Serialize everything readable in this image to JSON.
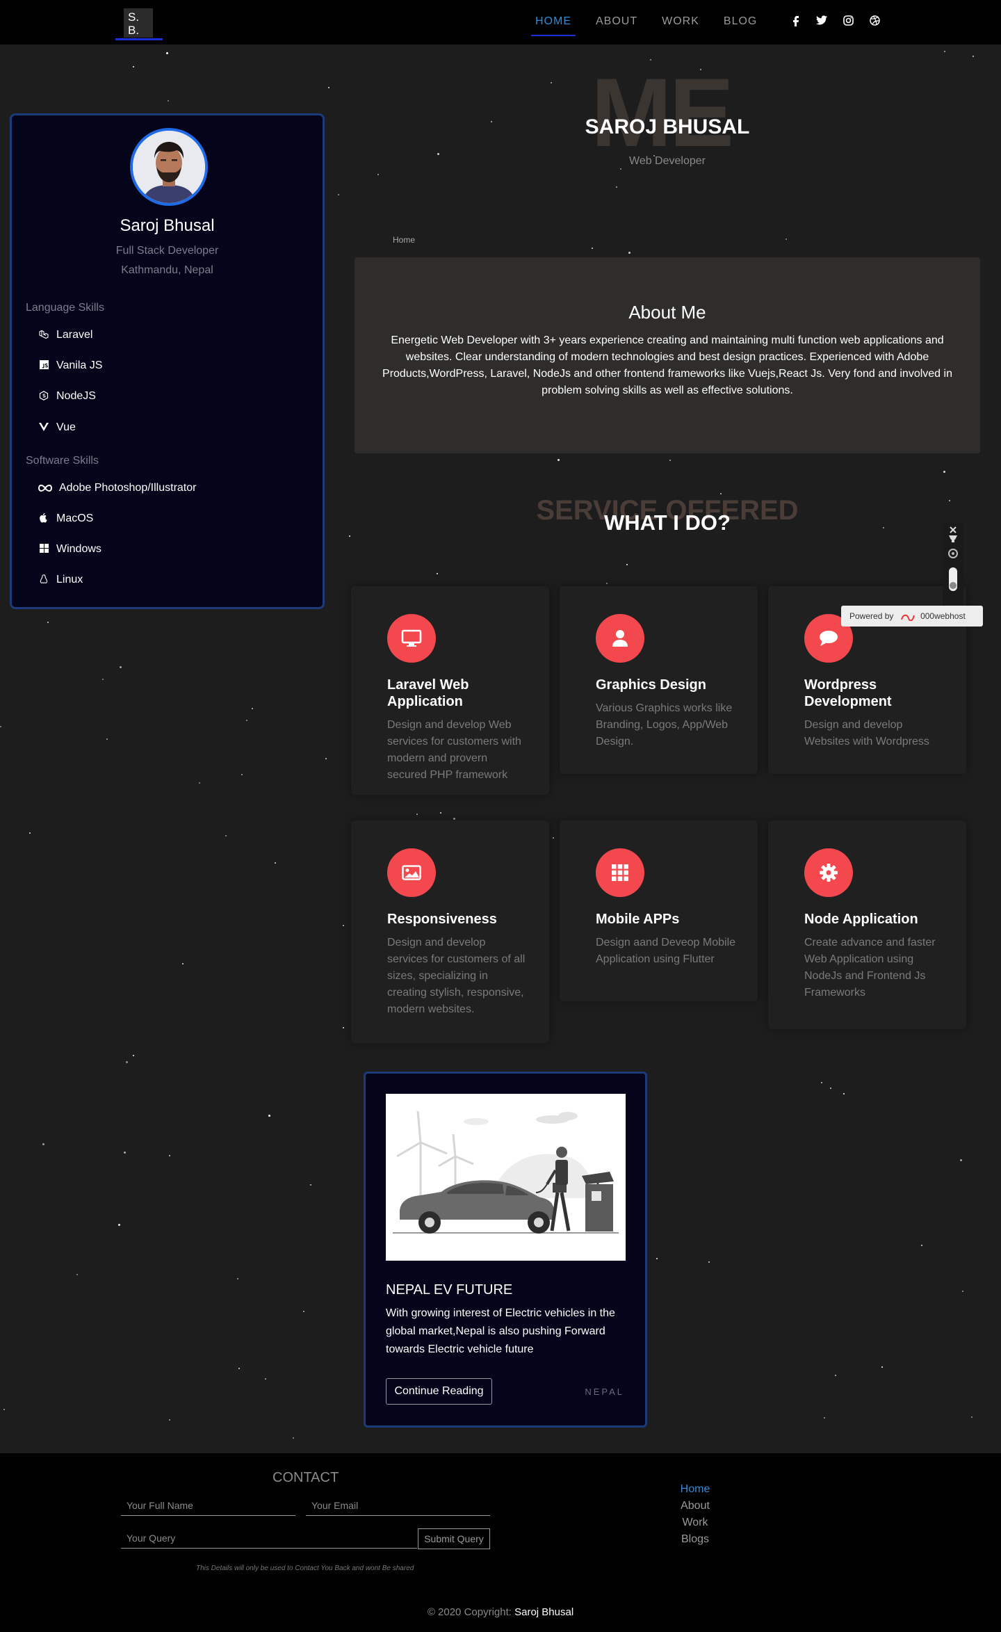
{
  "nav": {
    "logo": "S.\nB.",
    "links": [
      "HOME",
      "ABOUT",
      "WORK",
      "BLOG"
    ],
    "active": "HOME",
    "social_icons": [
      "facebook-icon",
      "twitter-icon",
      "instagram-icon",
      "dribbble-icon"
    ]
  },
  "sidebar": {
    "name": "Saroj Bhusal",
    "role": "Full Stack Developer",
    "location": "Kathmandu, Nepal",
    "language_heading": "Language Skills",
    "languages": [
      {
        "label": "Laravel",
        "icon": "laravel-icon"
      },
      {
        "label": "Vanila JS",
        "icon": "js-icon"
      },
      {
        "label": "NodeJS",
        "icon": "nodejs-icon"
      },
      {
        "label": "Vue",
        "icon": "vue-icon"
      }
    ],
    "software_heading": "Software Skills",
    "software": [
      {
        "label": "Adobe Photoshop/Illustrator",
        "icon": "infinity-icon"
      },
      {
        "label": "MacOS",
        "icon": "apple-icon"
      },
      {
        "label": "Windows",
        "icon": "windows-icon"
      },
      {
        "label": "Linux",
        "icon": "linux-icon"
      }
    ]
  },
  "hero": {
    "bg_text": "ME",
    "name": "SAROJ BHUSAL",
    "subtitle": "Web Developer",
    "breadcrumb": "Home"
  },
  "about": {
    "title": "About Me",
    "text": "Energetic Web Developer with 3+ years experience creating and maintaining multi function web applications and websites. Clear understanding of modern technologies and best design practices. Experienced with Adobe Products,WordPress, Laravel, NodeJs and other frontend frameworks like Vuejs,React Js. Very fond and involved in problem solving skills as well as effective solutions."
  },
  "services": {
    "bg_text": "SERVICE OFFERED",
    "title": "WHAT I DO?",
    "items": [
      {
        "title": "Laravel Web Application",
        "text": "Design and develop Web services for customers with modern and provern secured PHP framework",
        "icon": "monitor-icon"
      },
      {
        "title": "Graphics Design",
        "text": "Various Graphics works like Branding, Logos, App/Web Design.",
        "icon": "user-icon"
      },
      {
        "title": "Wordpress Development",
        "text": "Design and develop Websites with Wordpress",
        "icon": "chat-icon"
      },
      {
        "title": "Responsiveness",
        "text": "Design and develop services for customers of all sizes, specializing in creating stylish, responsive, modern websites.",
        "icon": "image-icon"
      },
      {
        "title": "Mobile APPs",
        "text": "Design aand Deveop Mobile Application using Flutter",
        "icon": "grid-icon"
      },
      {
        "title": "Node Application",
        "text": "Create advance and faster Web Application using NodeJs and Frontend Js Frameworks",
        "icon": "gear-icon"
      }
    ]
  },
  "blog": {
    "title": "NEPAL EV FUTURE",
    "text": "With growing interest of Electric vehicles in the global market,Nepal is also pushing Forward towards Electric vehicle future",
    "button": "Continue Reading",
    "tag": "NEPAL"
  },
  "powered": {
    "prefix": "Powered by",
    "brand": "000webhost"
  },
  "footer": {
    "contact_title": "CONTACT",
    "name_placeholder": "Your Full Name",
    "email_placeholder": "Your Email",
    "query_placeholder": "Your Query",
    "submit": "Submit Query",
    "disclaimer": "This Details will only be used to Contact You Back and wont Be shared",
    "links": [
      "Home",
      "About",
      "Work",
      "Blogs"
    ],
    "copyright": "© 2020 Copyright:",
    "copyright_name": "Saroj Bhusal"
  },
  "colors": {
    "accent": "#f3484e",
    "link_active": "#2f8cd6",
    "card_border": "#1c3b7a"
  }
}
